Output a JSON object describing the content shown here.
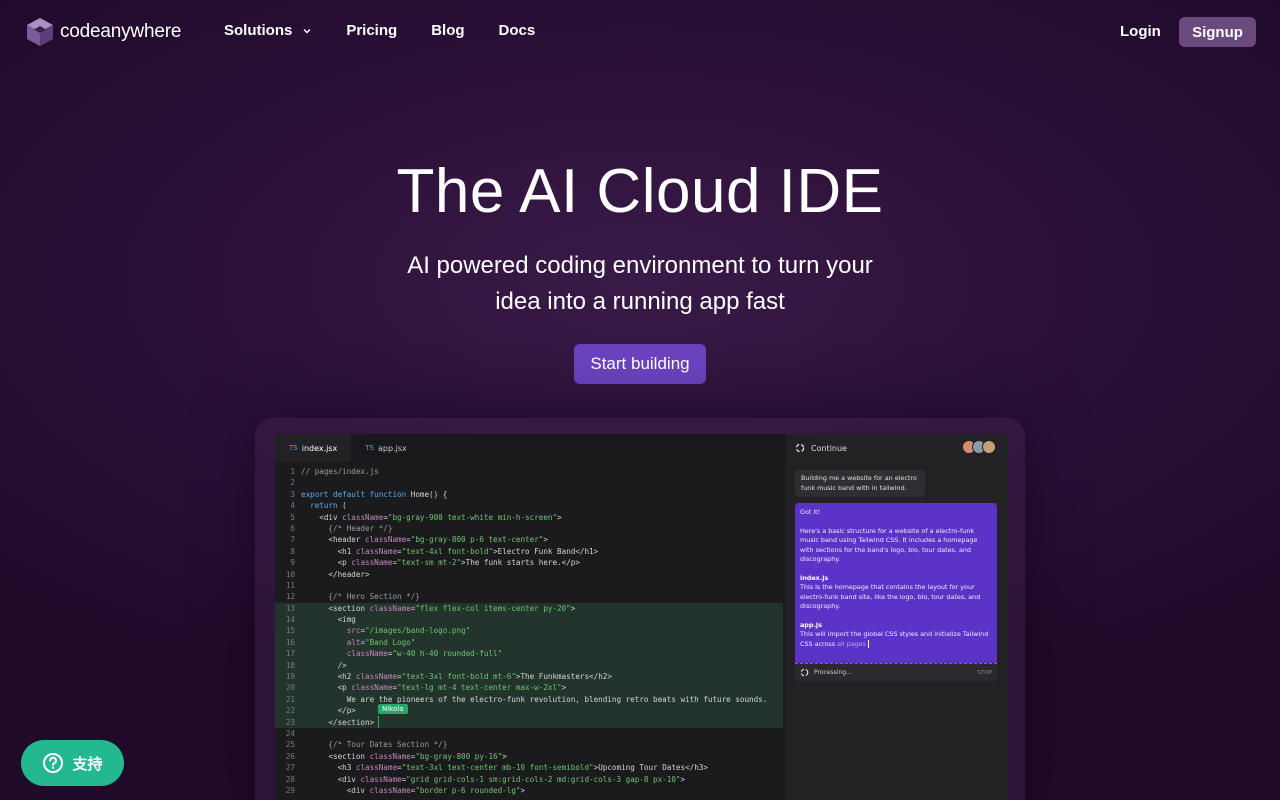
{
  "nav": {
    "logo_text": "codeanywhere",
    "links": [
      {
        "label": "Solutions"
      },
      {
        "label": "Pricing"
      },
      {
        "label": "Blog"
      },
      {
        "label": "Docs"
      }
    ],
    "login": "Login",
    "signup": "Signup"
  },
  "hero": {
    "title": "The AI Cloud IDE",
    "subtitle_line1": "AI powered coding environment to turn your",
    "subtitle_line2": "idea into a running app fast",
    "cta": "Start building"
  },
  "ide": {
    "tabs": [
      {
        "prefix": "TS",
        "label": "index.jsx"
      },
      {
        "prefix": "TS",
        "label": "app.jsx"
      }
    ],
    "code_lines": [
      {
        "n": "1",
        "text": "// pages/index.js"
      },
      {
        "n": "2",
        "text": ""
      },
      {
        "n": "3",
        "text": "export default function Home() {"
      },
      {
        "n": "4",
        "text": "  return ("
      },
      {
        "n": "5",
        "text": "    <div className=\"bg-gray-900 text-white min-h-screen\">"
      },
      {
        "n": "6",
        "text": "      {/* Header */}"
      },
      {
        "n": "7",
        "text": "      <header className=\"bg-gray-800 p-6 text-center\">"
      },
      {
        "n": "8",
        "text": "        <h1 className=\"text-4xl font-bold\">Electro Funk Band</h1>"
      },
      {
        "n": "9",
        "text": "        <p className=\"text-sm mt-2\">The funk starts here.</p>"
      },
      {
        "n": "10",
        "text": "      </header>"
      },
      {
        "n": "11",
        "text": ""
      },
      {
        "n": "12",
        "text": "      {/* Hero Section */}"
      },
      {
        "n": "13",
        "text": "      <section className=\"flex flex-col items-center py-20\">"
      },
      {
        "n": "14",
        "text": "        <img"
      },
      {
        "n": "15",
        "text": "          src=\"/images/band-logo.png\""
      },
      {
        "n": "16",
        "text": "          alt=\"Band Logo\""
      },
      {
        "n": "17",
        "text": "          className=\"w-40 h-40 rounded-full\""
      },
      {
        "n": "18",
        "text": "        />"
      },
      {
        "n": "19",
        "text": "        <h2 className=\"text-3xl font-bold mt-6\">The Funkmasters</h2>"
      },
      {
        "n": "20",
        "text": "        <p className=\"text-lg mt-4 text-center max-w-2xl\">"
      },
      {
        "n": "21",
        "text": "          We are the pioneers of the electro-funk revolution, blending retro beats with future sounds."
      },
      {
        "n": "22",
        "text": "        </p>"
      },
      {
        "n": "23",
        "text": "      </section>"
      },
      {
        "n": "24",
        "text": ""
      },
      {
        "n": "25",
        "text": "      {/* Tour Dates Section */}"
      },
      {
        "n": "26",
        "text": "      <section className=\"bg-gray-800 py-16\">"
      },
      {
        "n": "27",
        "text": "        <h3 className=\"text-3xl text-center mb-10 font-semibold\">Upcoming Tour Dates</h3>"
      },
      {
        "n": "28",
        "text": "        <div className=\"grid grid-cols-1 sm:grid-cols-2 md:grid-cols-3 gap-8 px-10\">"
      },
      {
        "n": "29",
        "text": "          <div className=\"border p-6 rounded-lg\">"
      }
    ],
    "highlighted_lines": [
      "13",
      "14",
      "15",
      "16",
      "17",
      "18",
      "19",
      "20",
      "21",
      "22",
      "23"
    ],
    "cursor_user": "Nikola",
    "chat": {
      "header": "Continue",
      "user_message": "Building me a website for an electro funk music band with in tailwind.",
      "ai_intro": "Got it!",
      "ai_p1": "Here's a basic structure for a website of a electro-funk music band using Tailwind CSS. It includes a homepage with sections for the band's logo, bio, tour dates, and discography.",
      "file1_name": "index.js",
      "file1_desc": "This is the homepage that contains the layout for your electro-funk band site, like the logo, bio, tour dates, and discography.",
      "file2_name": "app.js",
      "file2_desc": "This will import the global CSS styles and initialize Tailwind CSS across",
      "file2_faded": "all pages",
      "status": "Processing...",
      "stop": "STOP"
    }
  },
  "support": {
    "label": "支持"
  },
  "colors": {
    "cta": "#6b43c0",
    "signup_bg": "#6a4a7c",
    "support_bg": "#23b890",
    "ai_card": "#5b34c7",
    "code_highlight": "#22342c"
  }
}
